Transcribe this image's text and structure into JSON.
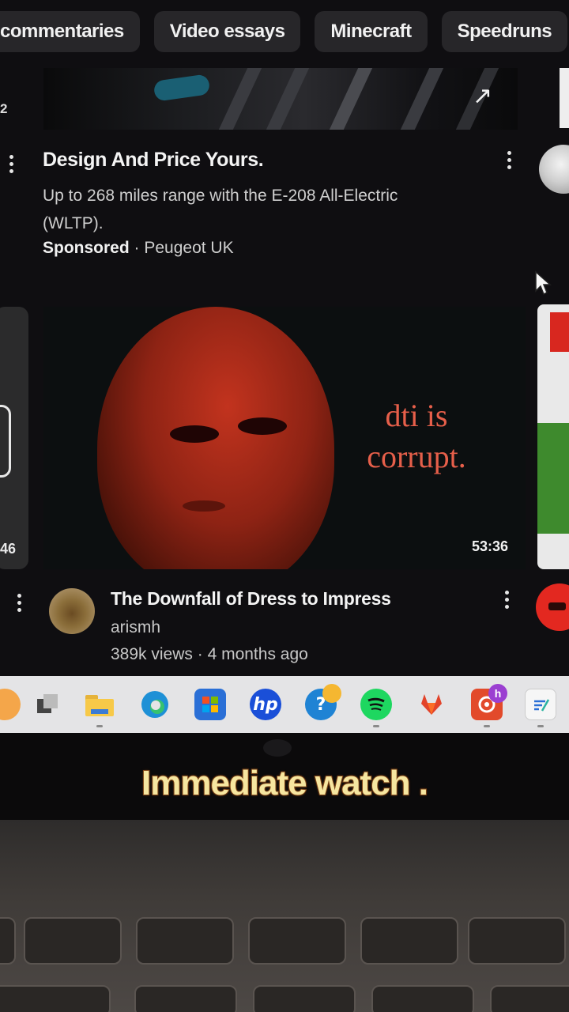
{
  "chips": [
    "commentaries",
    "Video essays",
    "Minecraft",
    "Speedruns"
  ],
  "ad": {
    "left_number": "2",
    "title": "Design And Price Yours.",
    "description": "Up to 268 miles range with the E-208 All-Electric (WLTP).",
    "sponsored_label": "Sponsored",
    "separator": " · ",
    "advertiser": "Peugeot UK",
    "external_icon": "↗"
  },
  "video": {
    "thumbnail_text_line1": "dti is",
    "thumbnail_text_line2": "corrupt.",
    "duration": "53:36",
    "left_partial_duration": "46",
    "title": "The Downfall of Dress to Impress",
    "channel": "arismh",
    "views": "389k views",
    "age": "4 months ago",
    "meta_separator": " · "
  },
  "taskbar": {
    "icons": [
      "task-view-icon",
      "file-explorer-icon",
      "edge-icon",
      "microsoft-store-icon",
      "hp-icon",
      "help-icon",
      "spotify-icon",
      "gitlab-icon",
      "app-icon",
      "notes-icon"
    ],
    "hp_label": "hp",
    "help_label": "?",
    "badge_label": "h"
  },
  "caption": "Immediate watch .",
  "colors": {
    "page_bg": "#0f0e11",
    "chip_bg": "#272629",
    "thumbnail_text": "#e65f4a",
    "caption_fill": "#f6e6a0",
    "caption_stroke": "#8a4a1a",
    "taskbar_bg": "#e4e4e6"
  }
}
